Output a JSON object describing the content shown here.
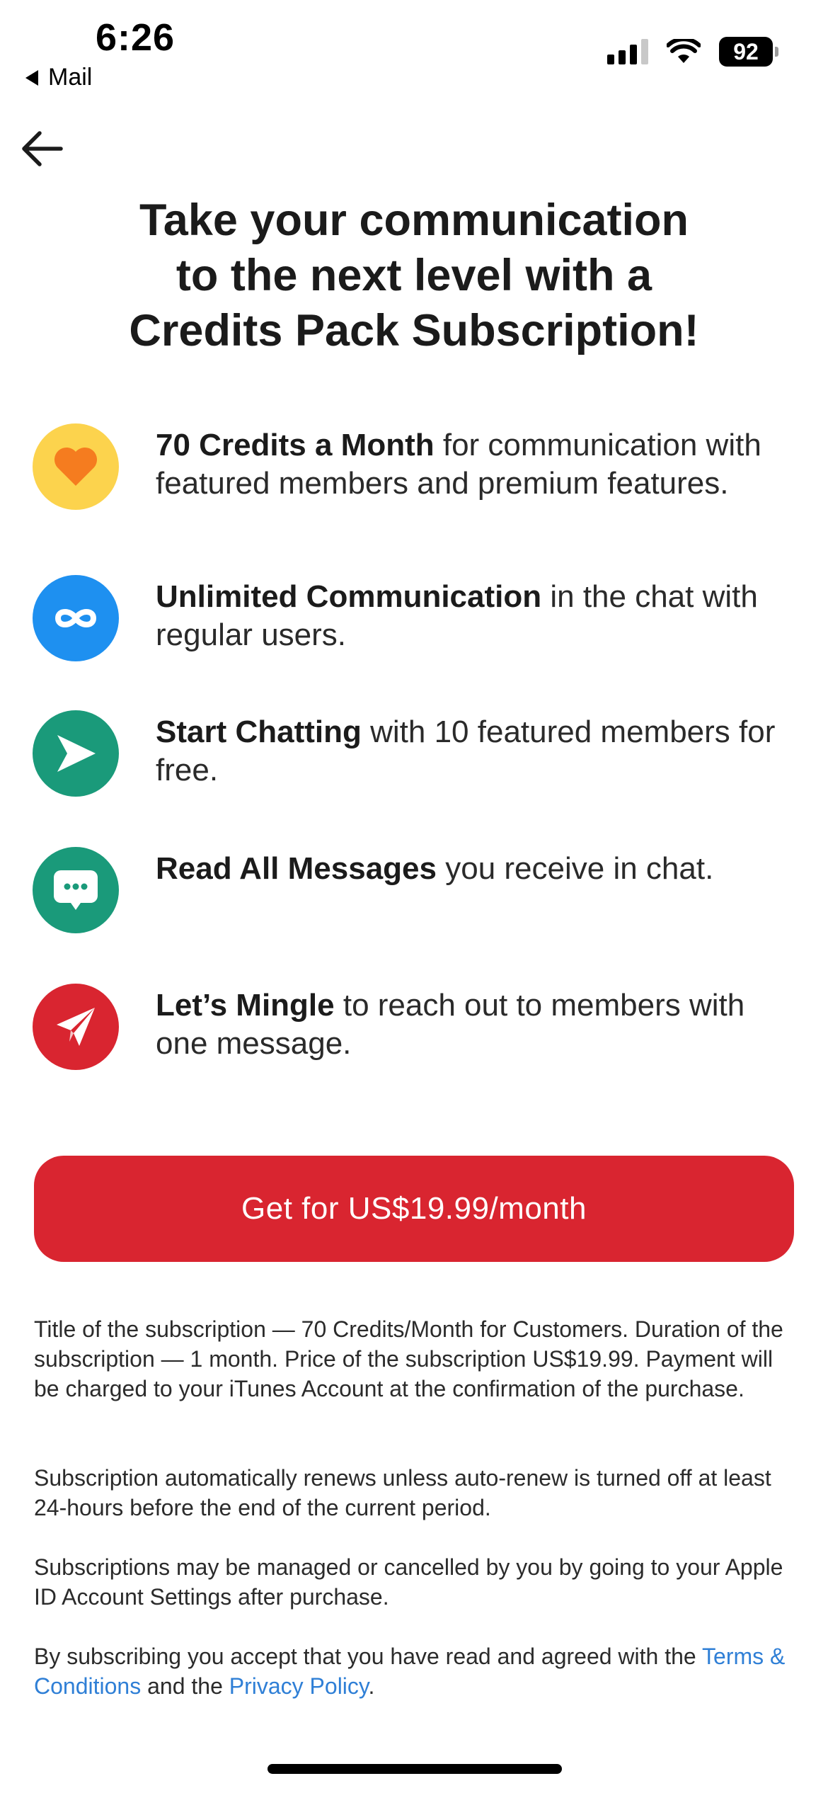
{
  "status_bar": {
    "time": "6:26",
    "back_app": "Mail",
    "battery": "92"
  },
  "header": {
    "back_icon": "arrow-left-icon",
    "title_lines": [
      "Take your communication",
      "to the next level with a",
      "Credits Pack Subscription!"
    ]
  },
  "features": [
    {
      "icon": "heart-icon",
      "color": "#fcd34d",
      "bold": "70 Credits a Month",
      "text": " for communication with featured members and premium features."
    },
    {
      "icon": "infinity-icon",
      "color": "#1e90f0",
      "bold": "Unlimited Communication",
      "text": " in the chat with regular users."
    },
    {
      "icon": "play-icon",
      "color": "#1a9a7a",
      "bold": "Start Chatting",
      "text": " with 10 featured members for free."
    },
    {
      "icon": "chat-bubble-icon",
      "color": "#1a9a7a",
      "bold": "Read All Messages",
      "text": " you receive in chat."
    },
    {
      "icon": "paper-plane-icon",
      "color": "#d92530",
      "bold": "Let’s Mingle",
      "text": " to reach out to members with one message."
    }
  ],
  "cta": {
    "label": "Get for  US$19.99/month",
    "color": "#d92530"
  },
  "legal": {
    "paragraph1": "Title of the subscription — 70 Credits/Month for Customers. Duration of the subscription — 1 month. Price of the subscription US$19.99. Payment will be charged to your iTunes Account at the confirmation of the purchase.",
    "paragraph2": "Subscription automatically renews unless auto-renew is turned off at least 24-hours before the end of the current period.",
    "paragraph3": "Subscriptions may be managed or cancelled by you by going to your Apple ID Account Settings after purchase.",
    "paragraph4_prefix": "By subscribing you accept that you have read and agreed with the ",
    "terms_link": "Terms & Conditions",
    "paragraph4_middle": " and the ",
    "privacy_link": "Privacy Policy",
    "paragraph4_suffix": ".",
    "link_color": "#2f7fd6"
  }
}
